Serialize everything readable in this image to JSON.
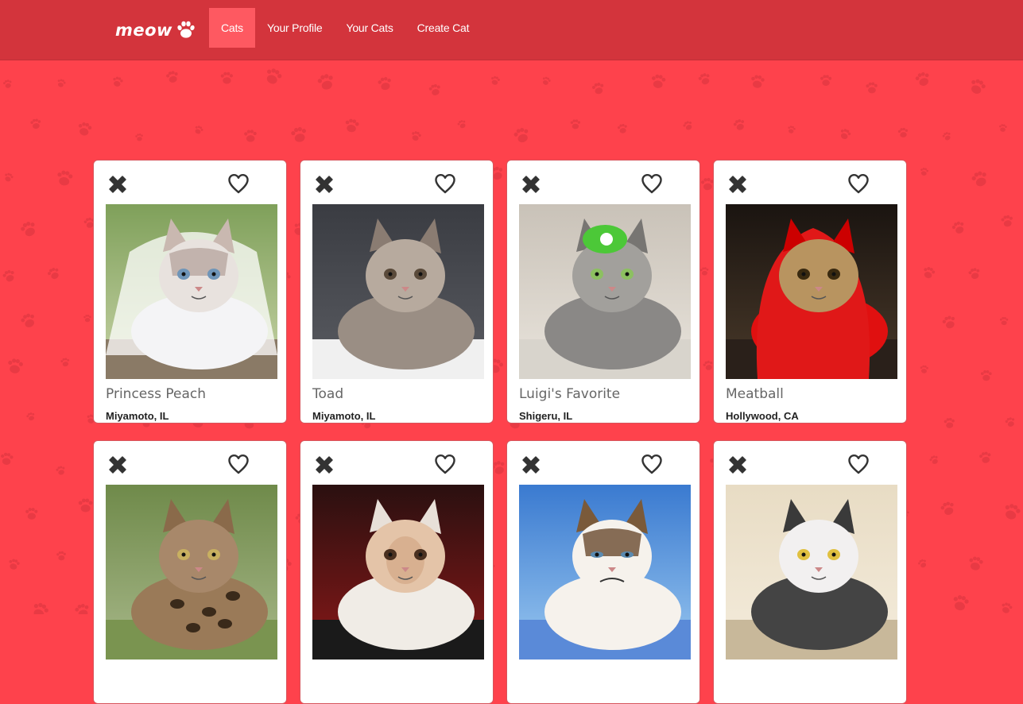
{
  "brand": {
    "name": "meow",
    "icon": "paw-icon"
  },
  "nav": {
    "items": [
      {
        "label": "Cats",
        "active": true
      },
      {
        "label": "Your Profile",
        "active": false
      },
      {
        "label": "Your Cats",
        "active": false
      },
      {
        "label": "Create Cat",
        "active": false
      }
    ]
  },
  "colors": {
    "background": "#fe424c",
    "navbar": "#d3343c",
    "nav_active": "#fe5961",
    "card": "#ffffff"
  },
  "card_actions": {
    "dismiss_icon": "close-icon",
    "like_icon": "heart-icon"
  },
  "cats": [
    {
      "name": "Princess Peach",
      "location": "Miyamoto, IL",
      "photo": "white-fluffy-cat-in-bridal-veil"
    },
    {
      "name": "Toad",
      "location": "Miyamoto, IL",
      "photo": "grey-persian-kitten-on-white-blanket"
    },
    {
      "name": "Luigi's Favorite",
      "location": "Shigeru, IL",
      "photo": "grey-tabby-cat-with-green-luigi-hat"
    },
    {
      "name": "Meatball",
      "location": "Hollywood, CA",
      "photo": "tabby-cat-in-red-hoodie"
    },
    {
      "name": "",
      "location": "",
      "photo": "bengal-cat-on-grass-with-harness"
    },
    {
      "name": "",
      "location": "",
      "photo": "white-cat-with-human-face-edit"
    },
    {
      "name": "",
      "location": "",
      "photo": "grumpy-cat"
    },
    {
      "name": "",
      "location": "",
      "photo": "cartoon-black-and-white-cat"
    }
  ]
}
